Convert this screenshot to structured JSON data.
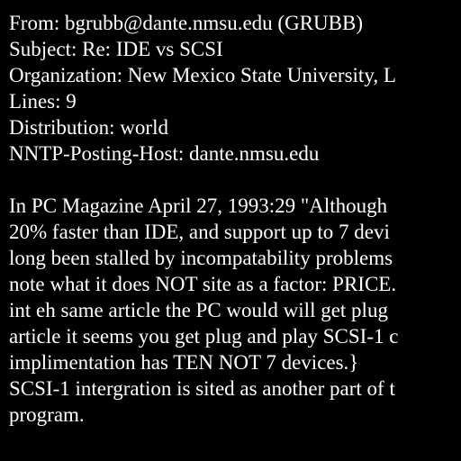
{
  "colors": {
    "background": "#000000",
    "text": "#ffffff"
  },
  "header": {
    "from": "From: bgrubb@dante.nmsu.edu (GRUBB)",
    "subject": "Subject: Re: IDE vs SCSI",
    "organization": "Organization: New Mexico State University, L",
    "lines": "Lines: 9",
    "distribution": "Distribution: world",
    "nntp_posting_host": "NNTP-Posting-Host: dante.nmsu.edu"
  },
  "body": {
    "lines": [
      "In PC Magazine April 27, 1993:29 \"Although",
      "20% faster than IDE, and support up to 7 devi",
      "long been stalled by incompatability problems",
      "note what it does NOT site as a factor: PRICE.",
      "int eh same article the PC would will get plug",
      "article it seems you get plug and play SCSI-1 c",
      "implimentation has TEN NOT 7 devices.}",
      "SCSI-1 intergration is sited as another part of t",
      "program."
    ]
  }
}
